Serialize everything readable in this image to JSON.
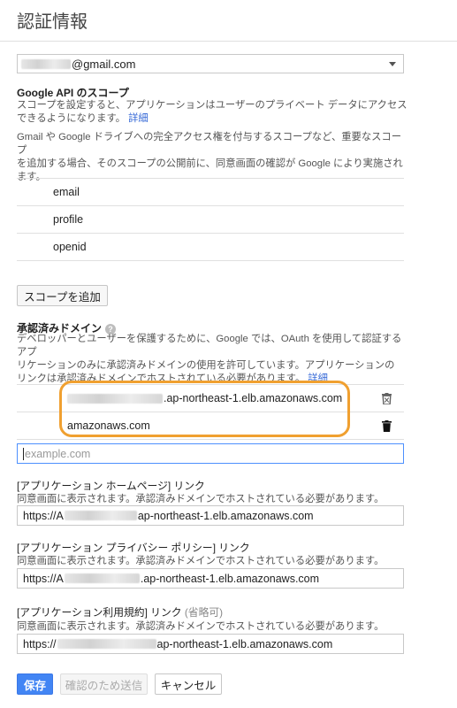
{
  "page": {
    "title": "認証情報"
  },
  "account": {
    "email_suffix": "@gmail.com"
  },
  "scopes": {
    "heading": "Google API のスコープ",
    "desc1": "スコープを設定すると、アプリケーションはユーザーのプライベート データにアクセス",
    "desc2": "できるようになります。",
    "detail_link": "詳細",
    "warn1": "Gmail や Google ドライブへの完全アクセス権を付与するスコープなど、重要なスコープ",
    "warn2": "を追加する場合、そのスコープの公開前に、同意画面の確認が Google により実施され",
    "warn3": "ます。",
    "items": [
      "email",
      "profile",
      "openid"
    ],
    "add_button": "スコープを追加"
  },
  "domains": {
    "heading": "承認済みドメイン",
    "help_icon": "?",
    "desc1": "デベロッパーとユーザーを保護するために、Google では、OAuth を使用して認証するアプ",
    "desc2": "リケーションのみに承認済みドメインの使用を許可しています。アプリケーションの",
    "desc3": "リンクは承認済みドメインでホストされている必要があります。",
    "detail_link": "詳細",
    "items": [
      {
        "suffix": ".ap-northeast-1.elb.amazonaws.com",
        "icon": "delete-outline-icon"
      },
      {
        "suffix": "amazonaws.com",
        "icon": "delete-icon"
      }
    ],
    "new_placeholder": "example.com"
  },
  "homepage": {
    "label": "[アプリケーション ホームページ] リンク",
    "desc": "同意画面に表示されます。承認済みドメインでホストされている必要があります。",
    "value_prefix": "https://A",
    "value_suffix": "ap-northeast-1.elb.amazonaws.com"
  },
  "privacy": {
    "label": "[アプリケーション プライバシー ポリシー] リンク",
    "desc": "同意画面に表示されます。承認済みドメインでホストされている必要があります。",
    "value_prefix": "https://A",
    "value_suffix": ".ap-northeast-1.elb.amazonaws.com"
  },
  "terms": {
    "label": "[アプリケーション利用規約] リンク",
    "optional": "(省略可)",
    "desc": "同意画面に表示されます。承認済みドメインでホストされている必要があります。",
    "value_prefix": "https://",
    "value_suffix": "ap-northeast-1.elb.amazonaws.com"
  },
  "actions": {
    "save": "保存",
    "submit": "確認のため送信",
    "cancel": "キャンセル"
  },
  "colors": {
    "primary": "#4285f4",
    "link": "#3367d6",
    "highlight": "#f0a030"
  }
}
